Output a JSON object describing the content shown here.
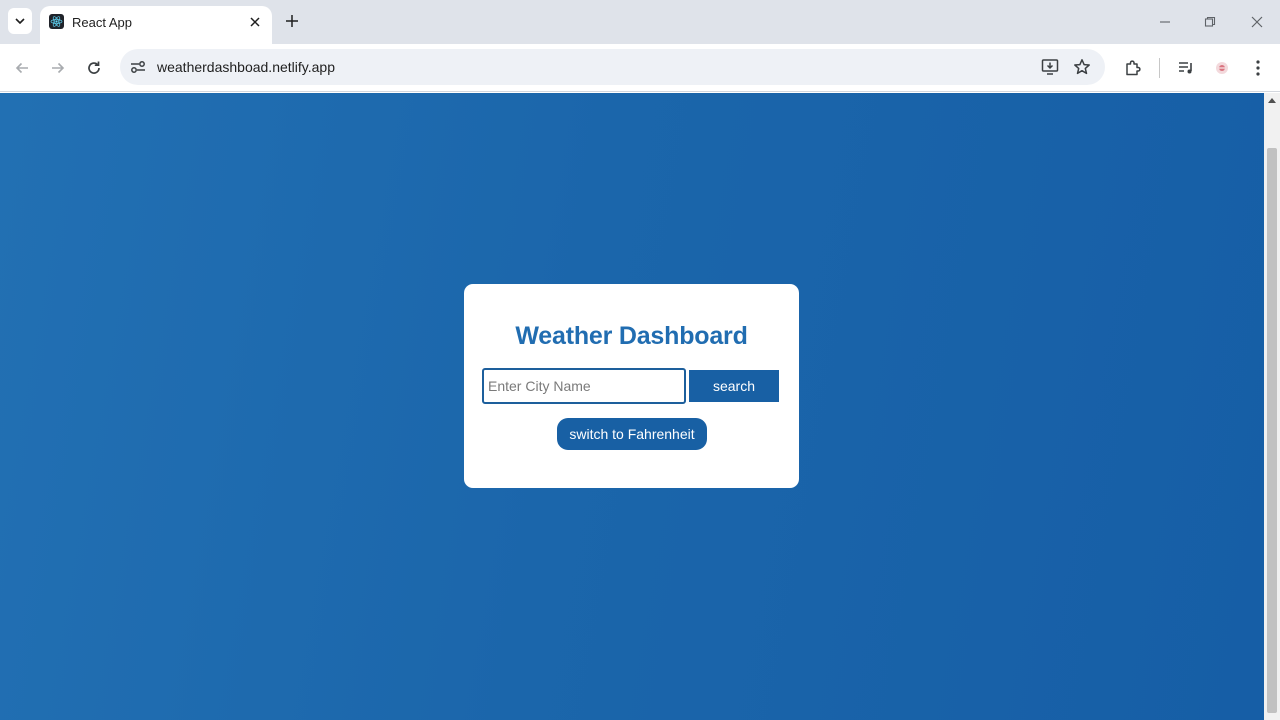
{
  "browser": {
    "tab": {
      "title": "React App",
      "favicon": "react-icon"
    },
    "address_bar": {
      "url": "weatherdashboad.netlify.app"
    },
    "icons": [
      "tab-search-icon",
      "close-icon",
      "plus-icon",
      "minimize-icon",
      "restore-icon",
      "window-close-icon",
      "back-arrow-icon",
      "forward-arrow-icon",
      "reload-icon",
      "site-info-icon",
      "install-app-icon",
      "bookmark-star-icon",
      "extensions-icon",
      "media-controls-icon",
      "profile-avatar-icon",
      "more-menu-icon"
    ]
  },
  "page": {
    "title": "Weather Dashboard",
    "search": {
      "placeholder": "Enter City Name",
      "value": "",
      "button_label": "search"
    },
    "unit_toggle_label": "switch to Fahrenheit"
  },
  "colors": {
    "background_gradient": [
      "#2270b3",
      "#165ea6"
    ],
    "title": "#216db1",
    "button": "#1860a4",
    "card": "#ffffff",
    "input_border": "#1d5f9c"
  }
}
